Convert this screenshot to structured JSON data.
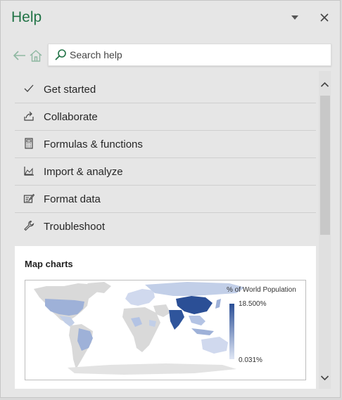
{
  "pane": {
    "title": "Help",
    "dropdown_icon": "chevron-down-icon",
    "close_icon": "close-icon"
  },
  "nav": {
    "back_icon": "back-arrow-icon",
    "home_icon": "home-icon"
  },
  "search": {
    "placeholder": "Search help",
    "value": "",
    "icon": "search-icon"
  },
  "topics": [
    {
      "label": "Get started",
      "icon": "checkmark-icon"
    },
    {
      "label": "Collaborate",
      "icon": "share-icon"
    },
    {
      "label": "Formulas & functions",
      "icon": "calculator-icon"
    },
    {
      "label": "Import & analyze",
      "icon": "chart-icon"
    },
    {
      "label": "Format data",
      "icon": "format-icon"
    },
    {
      "label": "Troubleshoot",
      "icon": "wrench-icon"
    }
  ],
  "card": {
    "title": "Map charts",
    "legend_title": "% of World Population",
    "legend_max": "18.500%",
    "legend_min": "0.031%",
    "colors": {
      "high": "#2b4f96",
      "low": "#dfe6f5",
      "no_data": "#d9d9d9"
    }
  },
  "scrollbar": {
    "up_icon": "scroll-up-icon",
    "down_icon": "scroll-down-icon"
  },
  "colors": {
    "accent": "#217346",
    "pane_bg": "#e6e6e6"
  }
}
